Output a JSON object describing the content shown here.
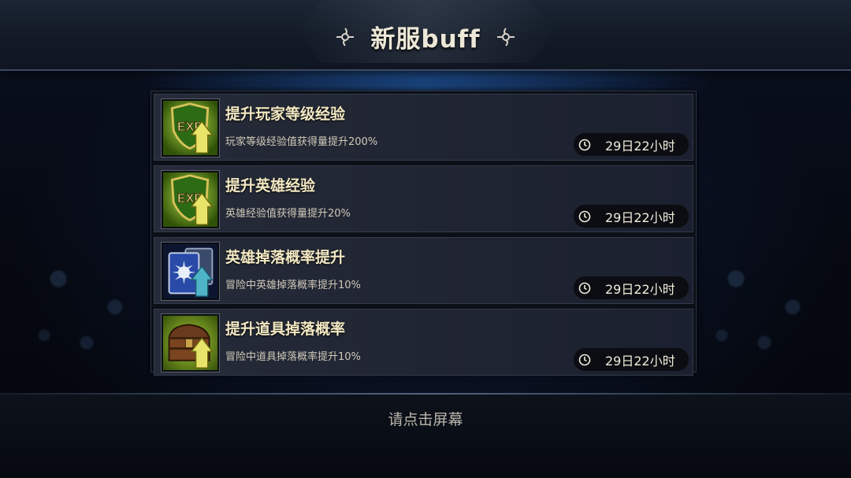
{
  "header": {
    "title": "新服buff"
  },
  "buffs": [
    {
      "title": "提升玩家等级经验",
      "desc": "玩家等级经验值获得量提升200%",
      "timer": "29日22小时",
      "icon": "exp-shield-arrow-icon"
    },
    {
      "title": "提升英雄经验",
      "desc": "英雄经验值获得量提升20%",
      "timer": "29日22小时",
      "icon": "exp-shield-arrow-icon"
    },
    {
      "title": "英雄掉落概率提升",
      "desc": "冒险中英雄掉落概率提升10%",
      "timer": "29日22小时",
      "icon": "hero-card-arrow-icon"
    },
    {
      "title": "提升道具掉落概率",
      "desc": "冒险中道具掉落概率提升10%",
      "timer": "29日22小时",
      "icon": "treasure-chest-arrow-icon"
    }
  ],
  "footer": {
    "hint": "请点击屏幕"
  },
  "colors": {
    "title_gold": "#f2e8c2",
    "exp_green": "#9ccf2a",
    "arrow_yellow": "#e8e46a",
    "card_blue": "#2a4aa8"
  }
}
